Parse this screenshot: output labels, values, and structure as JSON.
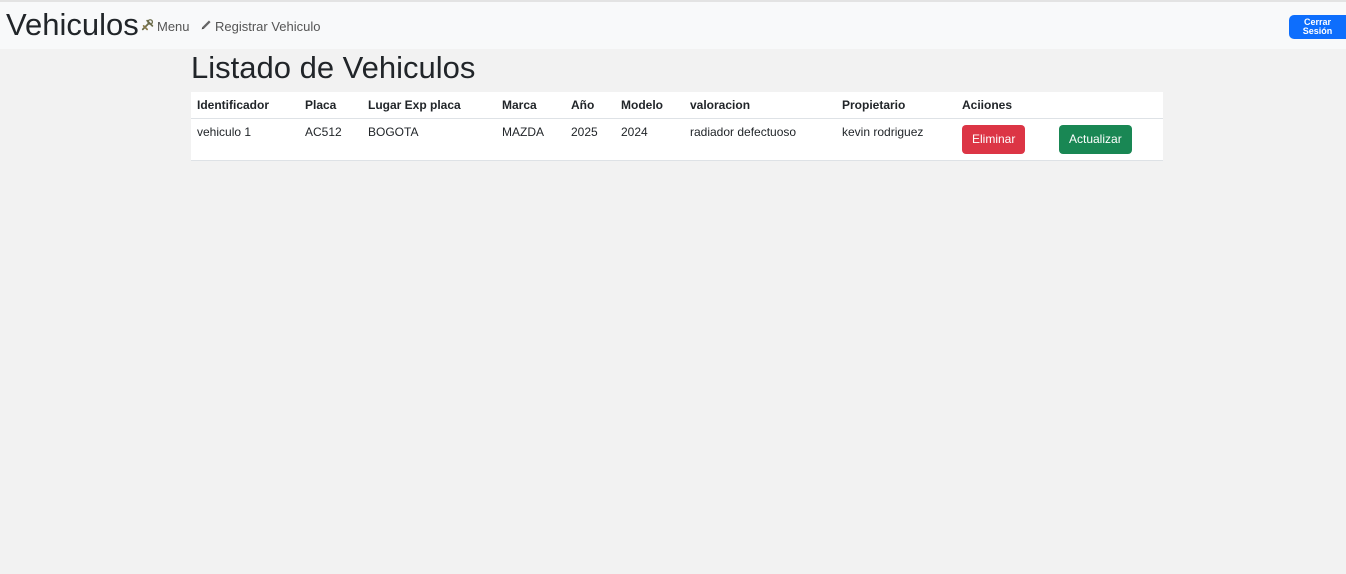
{
  "navbar": {
    "brand": "Vehiculos",
    "menu_label": "Menu",
    "register_label": "Registrar Vehiculo",
    "logout_line1": "Cerrar",
    "logout_line2": "Sesión"
  },
  "main": {
    "title": "Listado de Vehiculos",
    "table": {
      "headers": [
        "Identificador",
        "Placa",
        "Lugar Exp placa",
        "Marca",
        "Año",
        "Modelo",
        "valoracion",
        "Propietario",
        "Aciiones"
      ],
      "rows": [
        {
          "identificador": "vehiculo 1",
          "placa": "AC512",
          "lugar": "BOGOTA",
          "marca": "MAZDA",
          "anio": "2025",
          "modelo": "2024",
          "valoracion": "radiador defectuoso",
          "propietario": "kevin rodriguez",
          "delete_label": "Eliminar",
          "update_label": "Actualizar"
        }
      ]
    }
  },
  "colors": {
    "primary": "#0d6efd",
    "danger": "#dc3545",
    "success": "#198754"
  }
}
